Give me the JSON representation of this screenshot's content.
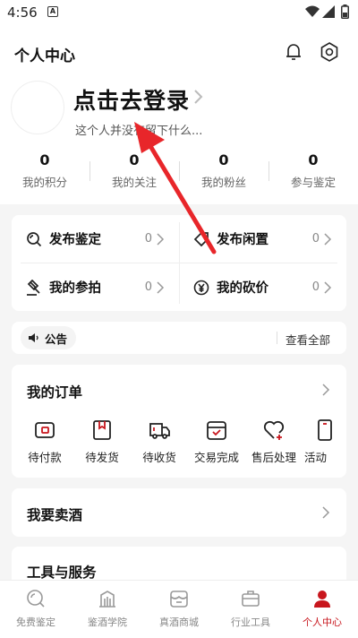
{
  "status_bar": {
    "time": "4:56",
    "notif_letter": "A"
  },
  "header": {
    "title": "个人中心"
  },
  "profile": {
    "login_title": "点击去登录",
    "subtitle": "这个人并没有留下什么..."
  },
  "stats": [
    {
      "value": "0",
      "label": "我的积分"
    },
    {
      "value": "0",
      "label": "我的关注"
    },
    {
      "value": "0",
      "label": "我的粉丝"
    },
    {
      "value": "0",
      "label": "参与鉴定"
    }
  ],
  "grid": [
    {
      "label": "发布鉴定",
      "count": "0",
      "icon": "search-icon"
    },
    {
      "label": "发布闲置",
      "count": "0",
      "icon": "tag-icon"
    },
    {
      "label": "我的参拍",
      "count": "0",
      "icon": "gavel-icon"
    },
    {
      "label": "我的砍价",
      "count": "0",
      "icon": "yen-icon"
    }
  ],
  "notice": {
    "label": "公告",
    "view_all": "查看全部"
  },
  "orders": {
    "title": "我的订单",
    "items": [
      {
        "label": "待付款",
        "icon": "wallet-icon"
      },
      {
        "label": "待发货",
        "icon": "package-icon"
      },
      {
        "label": "待收货",
        "icon": "truck-icon"
      },
      {
        "label": "交易完成",
        "icon": "box-check-icon"
      },
      {
        "label": "售后处理",
        "icon": "heart-plus-icon"
      },
      {
        "label": "活动",
        "icon": "phone-icon"
      }
    ]
  },
  "sell": {
    "title": "我要卖酒"
  },
  "tools": {
    "title": "工具与服务"
  },
  "bottom_nav": [
    {
      "label": "免费鉴定",
      "icon": "search-icon",
      "active": false
    },
    {
      "label": "鉴酒学院",
      "icon": "building-icon",
      "active": false
    },
    {
      "label": "真酒商城",
      "icon": "store-icon",
      "active": false
    },
    {
      "label": "行业工具",
      "icon": "briefcase-icon",
      "active": false
    },
    {
      "label": "个人中心",
      "icon": "person-icon",
      "active": true
    }
  ],
  "colors": {
    "accent": "#c8161d",
    "annotation_arrow": "#e8262a"
  }
}
